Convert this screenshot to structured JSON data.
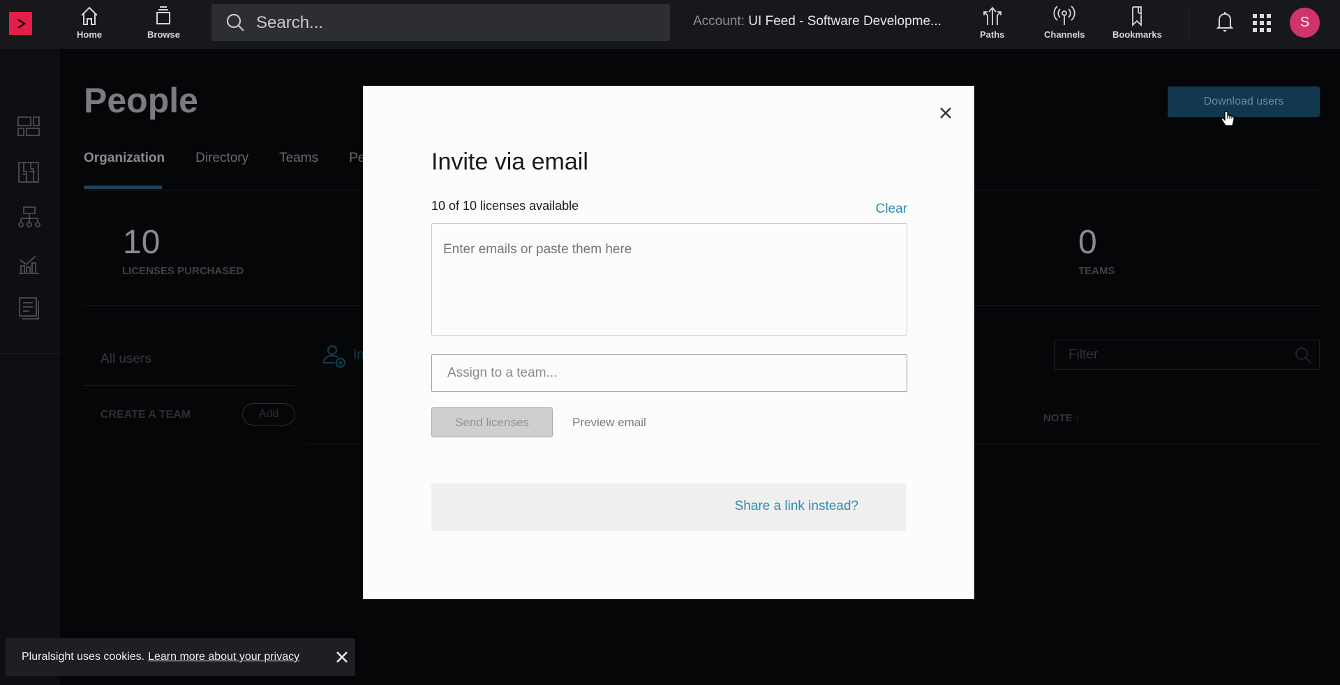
{
  "topbar": {
    "nav_left": [
      {
        "label": "Home",
        "icon": "home-icon"
      },
      {
        "label": "Browse",
        "icon": "browse-icon"
      }
    ],
    "search_placeholder": "Search...",
    "account_label": "Account:",
    "account_name": "UI Feed - Software Developme...",
    "nav_right": [
      {
        "label": "Paths",
        "icon": "paths-icon"
      },
      {
        "label": "Channels",
        "icon": "channels-icon"
      },
      {
        "label": "Bookmarks",
        "icon": "bookmark-icon"
      }
    ],
    "avatar_initial": "S"
  },
  "sidebar": {
    "icons": [
      "dashboard-icon",
      "skills-icon",
      "org-chart-icon",
      "analytics-icon",
      "reports-icon"
    ]
  },
  "page": {
    "title": "People",
    "tabs": [
      {
        "label": "Organization",
        "active": true
      },
      {
        "label": "Directory",
        "active": false
      },
      {
        "label": "Teams",
        "active": false
      },
      {
        "label": "Pe",
        "active": false
      }
    ],
    "download_button": "Download users",
    "stats": [
      {
        "value": "10",
        "label": "LICENSES PURCHASED"
      },
      {
        "value": "0",
        "label": "TEAMS"
      }
    ],
    "all_users": "All users",
    "create_team": "CREATE A TEAM",
    "add_button": "Add",
    "invite_partial": "In",
    "filter_placeholder": "Filter",
    "note_column": "NOTE"
  },
  "modal": {
    "title": "Invite via email",
    "license_count": "10 of 10 licenses available",
    "clear_label": "Clear",
    "email_placeholder": "Enter emails or paste them here",
    "team_placeholder": "Assign to a team...",
    "send_button": "Send licenses",
    "preview_link": "Preview email",
    "share_link": "Share a link instead?"
  },
  "cookie_banner": {
    "text": "Pluralsight uses cookies.",
    "link": "Learn more about your privacy"
  },
  "colors": {
    "brand": "#e41e49",
    "link": "#2f8db3",
    "avatar": "#d1336b",
    "download_button": "#11384f"
  }
}
